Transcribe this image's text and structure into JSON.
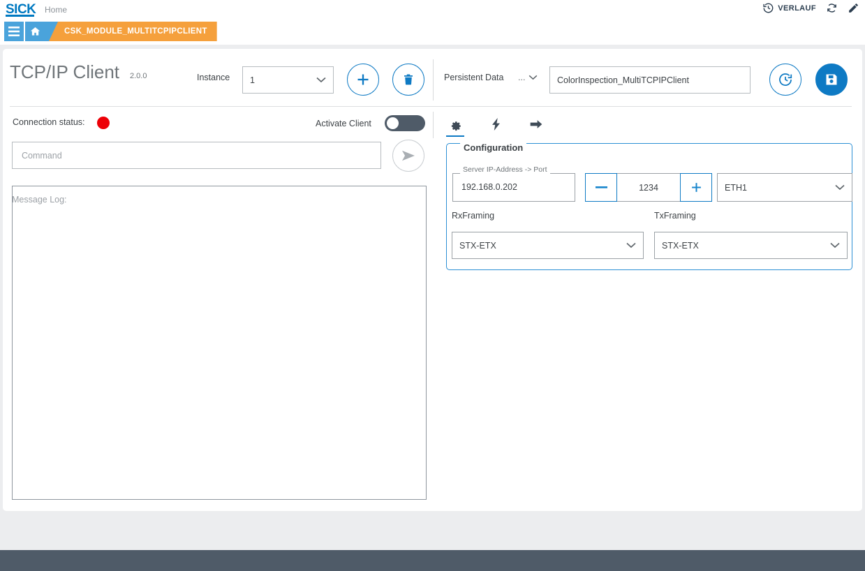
{
  "topbar": {
    "logo": "SICK",
    "home": "Home",
    "history_label": "VERLAUF",
    "icons": {
      "history": "history-icon",
      "refresh": "refresh-icon",
      "edit": "pencil-icon"
    }
  },
  "breadcrumb": {
    "menu_icon": "hamburger-menu-icon",
    "home_icon": "home-icon",
    "current": "CSK_MODULE_MULTITCPIPCLIENT"
  },
  "header": {
    "title": "TCP/IP Client",
    "version": "2.0.0",
    "instance_label": "Instance",
    "instance_value": "1",
    "add_icon": "plus-icon",
    "delete_icon": "trash-icon",
    "persistent_label": "Persistent Data",
    "persistent_dots": "...",
    "persistent_value": "ColorInspection_MultiTCPIPClient",
    "restore_icon": "restore-clock-icon",
    "save_icon": "floppy-save-icon"
  },
  "left": {
    "connection_label": "Connection status:",
    "connection_color": "#ed0007",
    "activate_label": "Activate Client",
    "toggle_state": "off",
    "command_placeholder": "Command",
    "send_icon": "send-paper-plane-icon",
    "message_log_placeholder": "Message Log:"
  },
  "right": {
    "tabs": [
      {
        "name": "gear-icon",
        "active": true
      },
      {
        "name": "lightning-icon",
        "active": false
      },
      {
        "name": "arrow-right-icon",
        "active": false
      }
    ],
    "configuration_legend": "Configuration",
    "ip_legend": "Server IP-Address -> Port",
    "ip_value": "192.168.0.202",
    "port_minus": "—",
    "port_value": "1234",
    "port_plus": "+",
    "interface_value": "ETH1",
    "rx_label": "RxFraming",
    "rx_value": "STX-ETX",
    "tx_label": "TxFraming",
    "tx_value": "STX-ETX"
  },
  "colors": {
    "brand_blue": "#0079c1",
    "accent_blue": "#0e7ac4",
    "nav_blue": "#4aa3db",
    "crumb_orange": "#f5a03c",
    "status_red": "#ed0007",
    "footer_slate": "#4f5b68"
  }
}
